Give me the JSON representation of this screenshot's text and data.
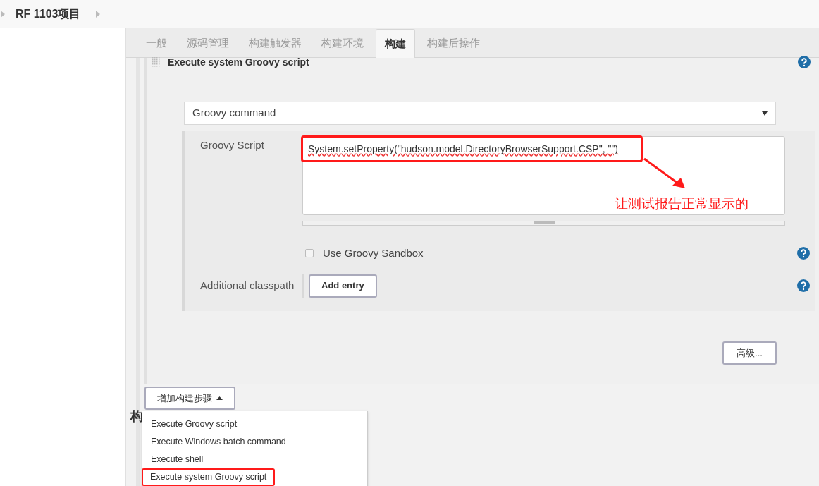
{
  "breadcrumb": {
    "project": "RF 1103项目"
  },
  "tabs": [
    {
      "label": "一般",
      "selected": false
    },
    {
      "label": "源码管理",
      "selected": false
    },
    {
      "label": "构建触发器",
      "selected": false
    },
    {
      "label": "构建环境",
      "selected": false
    },
    {
      "label": "构建",
      "selected": true
    },
    {
      "label": "构建后操作",
      "selected": false
    }
  ],
  "build_step": {
    "title": "Execute system Groovy script",
    "command_select": "Groovy command",
    "script_label": "Groovy Script",
    "script_value": "System.setProperty(\"hudson.model.DirectoryBrowserSupport.CSP\", \"\")",
    "annotation": "让测试报告正常显示的",
    "sandbox": {
      "label": "Use Groovy Sandbox",
      "checked": false
    },
    "classpath_label": "Additional classpath",
    "add_entry_button": "Add entry",
    "advanced_button": "高级..."
  },
  "add_step_button": "增加构建步骤",
  "section_heading": "构",
  "menu_items": [
    {
      "label": "Execute Groovy script",
      "annotated": false
    },
    {
      "label": "Execute Windows batch command",
      "annotated": false
    },
    {
      "label": "Execute shell",
      "annotated": false
    },
    {
      "label": "Execute system Groovy script",
      "annotated": true
    }
  ]
}
